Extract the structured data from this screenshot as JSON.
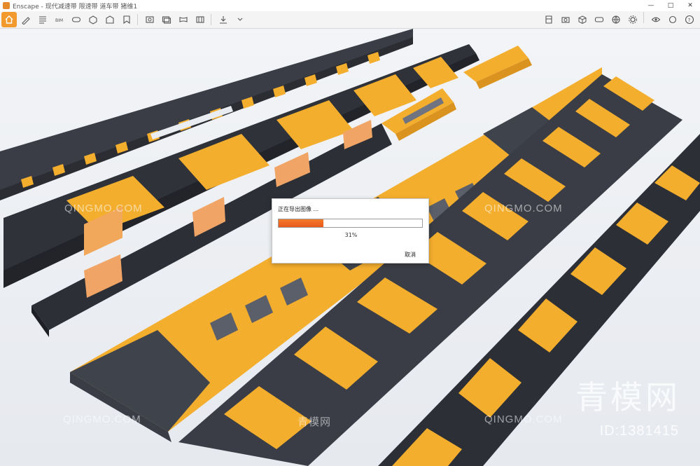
{
  "window": {
    "app_name": "Enscape",
    "title": "Enscape - 现代减速带 限速带 道车带 猪维1",
    "controls": {
      "minimize": "—",
      "maximize": "□",
      "close": "✕"
    }
  },
  "toolbar": {
    "active_icon": "home-icon",
    "accent": "#f29a2e"
  },
  "dialog": {
    "title": "正在导出图像 ...",
    "progress": 31,
    "percent_label": "31%",
    "cancel_label": "取消"
  },
  "watermarks": {
    "site": "QINGMO.COM",
    "site_cn": "青模网",
    "big_text": "青模网",
    "id_text": "ID:1381415"
  },
  "colors": {
    "bump_yellow": "#f3ae2e",
    "bump_dark": "#3a3d45",
    "background": "#eef0f3"
  }
}
